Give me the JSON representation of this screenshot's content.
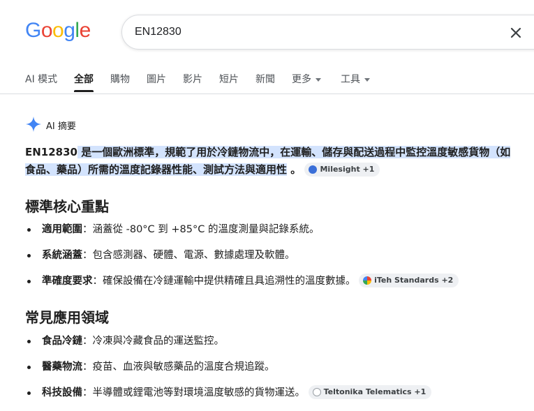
{
  "logo": {
    "letters": [
      "G",
      "o",
      "o",
      "g",
      "l",
      "e"
    ],
    "colors": [
      "#4285F4",
      "#EA4335",
      "#FBBC05",
      "#4285F4",
      "#34A853",
      "#EA4335"
    ]
  },
  "search": {
    "value": "EN12830"
  },
  "tabs": [
    {
      "label": "AI 模式"
    },
    {
      "label": "全部",
      "active": true
    },
    {
      "label": "購物"
    },
    {
      "label": "圖片"
    },
    {
      "label": "影片"
    },
    {
      "label": "短片"
    },
    {
      "label": "新聞"
    },
    {
      "label": "更多"
    },
    {
      "label": "工具"
    }
  ],
  "ai_overview": {
    "label": "AI 摘要",
    "summary_term": "EN12830",
    "summary_text": " 是一個歐洲標準，規範了用於冷鏈物流中，在運輸、儲存與配送過程中監控溫度敏感貨物（如食品、藥品）所需的溫度記錄器性能、測試方法與適用性",
    "summary_end": " 。",
    "summary_chip": "Milesight +1"
  },
  "sections": [
    {
      "title": "標準核心重點",
      "items": [
        {
          "term": "適用範圍",
          "text": "：涵蓋從 -80°C 到 +85°C 的溫度測量與記錄系統。",
          "chip": ""
        },
        {
          "term": "系統涵蓋",
          "text": "：包含感測器、硬體、電源、數據處理及軟體。",
          "chip": ""
        },
        {
          "term": "準確度要求",
          "text": "：確保設備在冷鏈運輸中提供精確且具追溯性的溫度數據。",
          "chip": "iTeh Standards +2"
        }
      ]
    },
    {
      "title": "常見應用領域",
      "items": [
        {
          "term": "食品冷鏈",
          "text": "：冷凍與冷藏食品的運送監控。",
          "chip": ""
        },
        {
          "term": "醫藥物流",
          "text": "：疫苗、血液與敏感藥品的溫度合規追蹤。",
          "chip": ""
        },
        {
          "term": "科技設備",
          "text": "：半導體或鋰電池等對環境溫度敏感的貨物運送。",
          "chip": "Teltonika Telematics +1"
        }
      ]
    }
  ],
  "icons": {
    "clear": "close-icon",
    "ai": "sparkle-icon",
    "chip_1": "milesight-favicon-icon",
    "chip_2": "iteh-favicon-icon",
    "chip_3": "teltonika-favicon-icon"
  },
  "colors": {
    "ai_accent": "#4285F4",
    "highlight": "#d3e3fd",
    "chip_bg": "#eef0f3"
  }
}
